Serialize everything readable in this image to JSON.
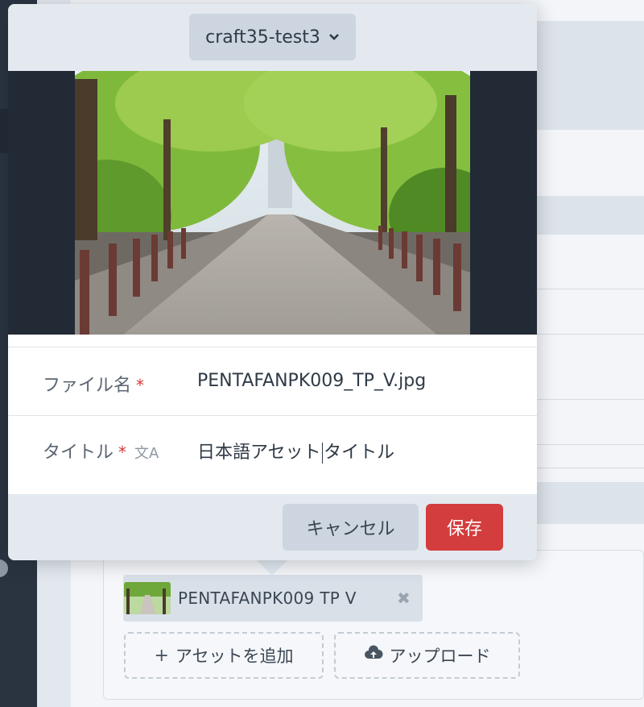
{
  "modal": {
    "site_select": {
      "value": "craft35-test3",
      "icon": "chevron-down-icon"
    },
    "fields": {
      "filename": {
        "label": "ファイル名",
        "required_mark": "*",
        "value": "PENTAFANPK009_TP_V.jpg"
      },
      "title": {
        "label": "タイトル",
        "required_mark": "*",
        "translate_icon": "translate-icon",
        "value_before_cursor": "日本語アセット",
        "value_after_cursor": "タイトル"
      }
    },
    "footer": {
      "cancel_label": "キャンセル",
      "save_label": "保存"
    }
  },
  "asset_field": {
    "selected_asset": {
      "label": "PENTAFANPK009 TP V",
      "remove_icon": "✖"
    },
    "add_label": "アセットを追加",
    "add_icon": "+",
    "upload_label": "アップロード",
    "upload_icon": "cloud-upload-icon"
  },
  "colors": {
    "save": "#d43d3d",
    "header": "#e4e9f0",
    "sidebar": "#2a3340"
  }
}
